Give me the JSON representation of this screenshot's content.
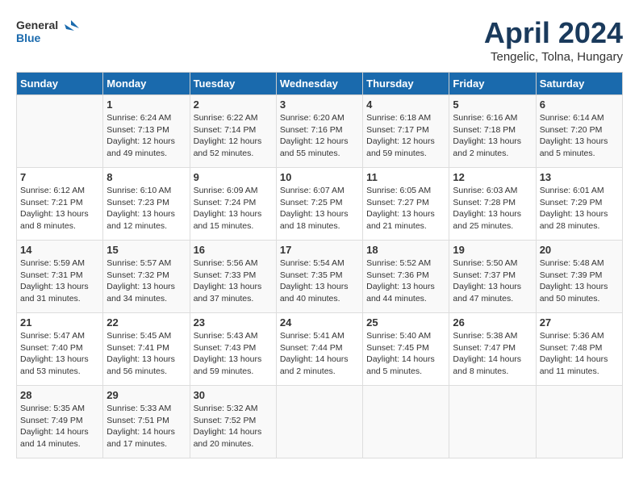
{
  "header": {
    "logo_general": "General",
    "logo_blue": "Blue",
    "title": "April 2024",
    "subtitle": "Tengelic, Tolna, Hungary"
  },
  "calendar": {
    "days_of_week": [
      "Sunday",
      "Monday",
      "Tuesday",
      "Wednesday",
      "Thursday",
      "Friday",
      "Saturday"
    ],
    "weeks": [
      [
        {
          "day": "",
          "info": ""
        },
        {
          "day": "1",
          "info": "Sunrise: 6:24 AM\nSunset: 7:13 PM\nDaylight: 12 hours\nand 49 minutes."
        },
        {
          "day": "2",
          "info": "Sunrise: 6:22 AM\nSunset: 7:14 PM\nDaylight: 12 hours\nand 52 minutes."
        },
        {
          "day": "3",
          "info": "Sunrise: 6:20 AM\nSunset: 7:16 PM\nDaylight: 12 hours\nand 55 minutes."
        },
        {
          "day": "4",
          "info": "Sunrise: 6:18 AM\nSunset: 7:17 PM\nDaylight: 12 hours\nand 59 minutes."
        },
        {
          "day": "5",
          "info": "Sunrise: 6:16 AM\nSunset: 7:18 PM\nDaylight: 13 hours\nand 2 minutes."
        },
        {
          "day": "6",
          "info": "Sunrise: 6:14 AM\nSunset: 7:20 PM\nDaylight: 13 hours\nand 5 minutes."
        }
      ],
      [
        {
          "day": "7",
          "info": "Sunrise: 6:12 AM\nSunset: 7:21 PM\nDaylight: 13 hours\nand 8 minutes."
        },
        {
          "day": "8",
          "info": "Sunrise: 6:10 AM\nSunset: 7:23 PM\nDaylight: 13 hours\nand 12 minutes."
        },
        {
          "day": "9",
          "info": "Sunrise: 6:09 AM\nSunset: 7:24 PM\nDaylight: 13 hours\nand 15 minutes."
        },
        {
          "day": "10",
          "info": "Sunrise: 6:07 AM\nSunset: 7:25 PM\nDaylight: 13 hours\nand 18 minutes."
        },
        {
          "day": "11",
          "info": "Sunrise: 6:05 AM\nSunset: 7:27 PM\nDaylight: 13 hours\nand 21 minutes."
        },
        {
          "day": "12",
          "info": "Sunrise: 6:03 AM\nSunset: 7:28 PM\nDaylight: 13 hours\nand 25 minutes."
        },
        {
          "day": "13",
          "info": "Sunrise: 6:01 AM\nSunset: 7:29 PM\nDaylight: 13 hours\nand 28 minutes."
        }
      ],
      [
        {
          "day": "14",
          "info": "Sunrise: 5:59 AM\nSunset: 7:31 PM\nDaylight: 13 hours\nand 31 minutes."
        },
        {
          "day": "15",
          "info": "Sunrise: 5:57 AM\nSunset: 7:32 PM\nDaylight: 13 hours\nand 34 minutes."
        },
        {
          "day": "16",
          "info": "Sunrise: 5:56 AM\nSunset: 7:33 PM\nDaylight: 13 hours\nand 37 minutes."
        },
        {
          "day": "17",
          "info": "Sunrise: 5:54 AM\nSunset: 7:35 PM\nDaylight: 13 hours\nand 40 minutes."
        },
        {
          "day": "18",
          "info": "Sunrise: 5:52 AM\nSunset: 7:36 PM\nDaylight: 13 hours\nand 44 minutes."
        },
        {
          "day": "19",
          "info": "Sunrise: 5:50 AM\nSunset: 7:37 PM\nDaylight: 13 hours\nand 47 minutes."
        },
        {
          "day": "20",
          "info": "Sunrise: 5:48 AM\nSunset: 7:39 PM\nDaylight: 13 hours\nand 50 minutes."
        }
      ],
      [
        {
          "day": "21",
          "info": "Sunrise: 5:47 AM\nSunset: 7:40 PM\nDaylight: 13 hours\nand 53 minutes."
        },
        {
          "day": "22",
          "info": "Sunrise: 5:45 AM\nSunset: 7:41 PM\nDaylight: 13 hours\nand 56 minutes."
        },
        {
          "day": "23",
          "info": "Sunrise: 5:43 AM\nSunset: 7:43 PM\nDaylight: 13 hours\nand 59 minutes."
        },
        {
          "day": "24",
          "info": "Sunrise: 5:41 AM\nSunset: 7:44 PM\nDaylight: 14 hours\nand 2 minutes."
        },
        {
          "day": "25",
          "info": "Sunrise: 5:40 AM\nSunset: 7:45 PM\nDaylight: 14 hours\nand 5 minutes."
        },
        {
          "day": "26",
          "info": "Sunrise: 5:38 AM\nSunset: 7:47 PM\nDaylight: 14 hours\nand 8 minutes."
        },
        {
          "day": "27",
          "info": "Sunrise: 5:36 AM\nSunset: 7:48 PM\nDaylight: 14 hours\nand 11 minutes."
        }
      ],
      [
        {
          "day": "28",
          "info": "Sunrise: 5:35 AM\nSunset: 7:49 PM\nDaylight: 14 hours\nand 14 minutes."
        },
        {
          "day": "29",
          "info": "Sunrise: 5:33 AM\nSunset: 7:51 PM\nDaylight: 14 hours\nand 17 minutes."
        },
        {
          "day": "30",
          "info": "Sunrise: 5:32 AM\nSunset: 7:52 PM\nDaylight: 14 hours\nand 20 minutes."
        },
        {
          "day": "",
          "info": ""
        },
        {
          "day": "",
          "info": ""
        },
        {
          "day": "",
          "info": ""
        },
        {
          "day": "",
          "info": ""
        }
      ]
    ]
  }
}
